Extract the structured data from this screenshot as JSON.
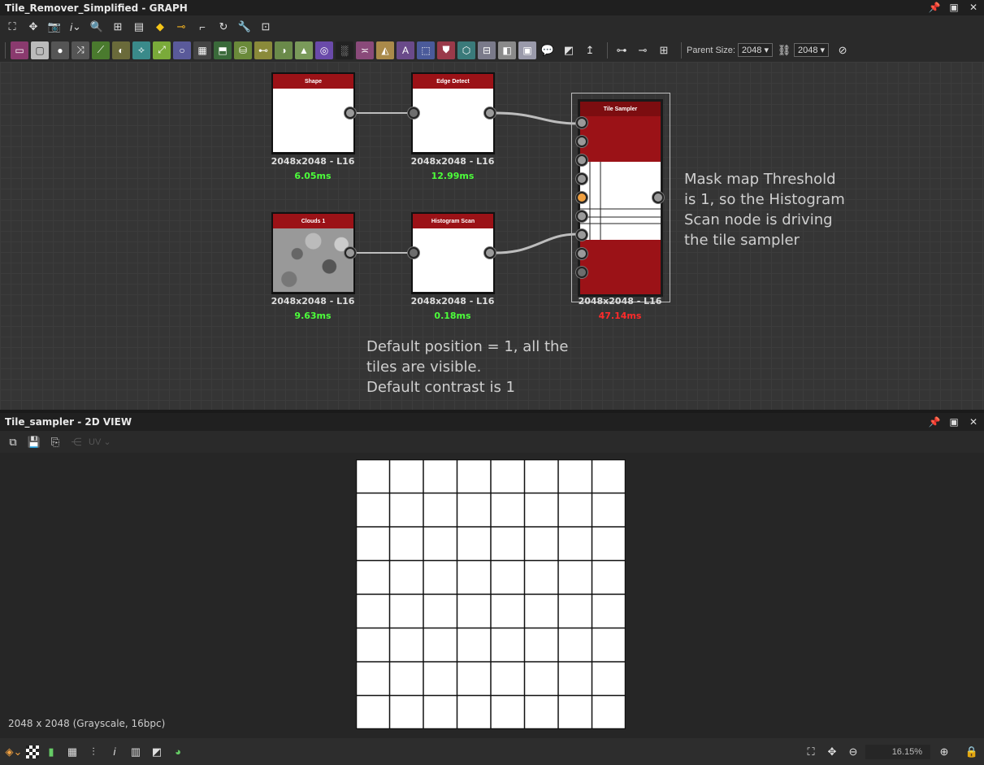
{
  "graph_panel": {
    "title": "Tile_Remover_Simplified - GRAPH",
    "parent_size_label": "Parent Size:",
    "parent_size_w": "2048",
    "parent_size_h": "2048"
  },
  "nodes": {
    "shape": {
      "name": "Shape",
      "size": "2048x2048 - L16",
      "time": "6.05ms",
      "time_color": "#4cff3a"
    },
    "edge": {
      "name": "Edge Detect",
      "size": "2048x2048 - L16",
      "time": "12.99ms",
      "time_color": "#4cff3a"
    },
    "clouds": {
      "name": "Clouds 1",
      "size": "2048x2048 - L16",
      "time": "9.63ms",
      "time_color": "#4cff3a"
    },
    "hist": {
      "name": "Histogram Scan",
      "size": "2048x2048 - L16",
      "time": "0.18ms",
      "time_color": "#4cff3a"
    },
    "tile": {
      "name": "Tile Sampler",
      "size": "2048x2048 - L16",
      "time": "47.14ms",
      "time_color": "#ff2a2a"
    }
  },
  "comments": {
    "mask_1": "Mask map Threshold",
    "mask_2": "is 1, so the Histogram",
    "mask_3": "Scan node is driving",
    "mask_4": "the tile sampler",
    "default_1": "Default position = 1, all the",
    "default_2": "tiles are visible.",
    "default_3": "Default contrast is 1"
  },
  "view_panel": {
    "title": "Tile_sampler - 2D VIEW",
    "uv_label": "UV",
    "image_info": "2048 x 2048 (Grayscale, 16bpc)",
    "zoom": "16.15%",
    "grid_cells": 8
  },
  "icons": {
    "atomic": [
      "bitmap",
      "svg",
      "fxmap",
      "gradient-map",
      "curve",
      "blur",
      "warp",
      "transform",
      "shape",
      "pixel-processor",
      "fx-map",
      "blend",
      "levels",
      "histogram",
      "hsl",
      "uniform-color",
      "text",
      "distance",
      "tile-sampler",
      "normal",
      "edge",
      "output",
      "input",
      "comment",
      "frame",
      "pin"
    ]
  }
}
